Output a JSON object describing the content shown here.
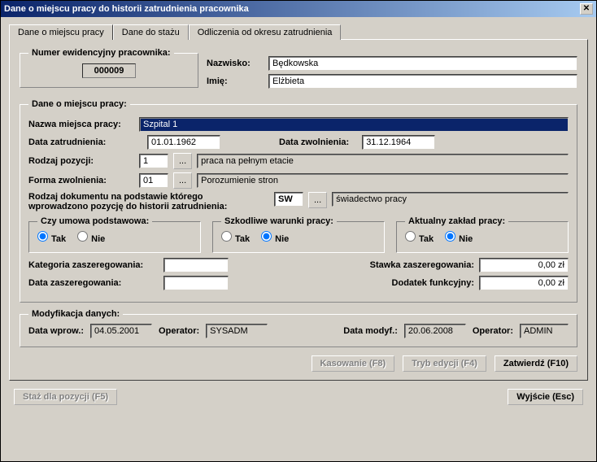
{
  "window": {
    "title": "Dane o miejscu pracy do historii zatrudnienia pracownika"
  },
  "tabs": {
    "t1": "Dane o miejscu pracy",
    "t2": "Dane do stażu",
    "t3": "Odliczenia od okresu zatrudnienia"
  },
  "emp": {
    "group_label": "Numer ewidencyjny pracownika:",
    "id": "000009",
    "surname_label": "Nazwisko:",
    "surname": "Będkowska",
    "firstname_label": "Imię:",
    "firstname": "Elżbieta"
  },
  "workplace": {
    "group_label": "Dane o miejscu pracy:",
    "name_label": "Nazwa miejsca pracy:",
    "name": "Szpital 1",
    "hire_date_label": "Data zatrudnienia:",
    "hire_date": "01.01.1962",
    "term_date_label": "Data zwolnienia:",
    "term_date": "31.12.1964",
    "position_type_label": "Rodzaj pozycji:",
    "position_type_code": "1",
    "position_type_desc": "praca na pełnym etacie",
    "term_form_label": "Forma zwolnienia:",
    "term_form_code": "01",
    "term_form_desc": "Porozumienie stron",
    "doc_type_label_1": "Rodzaj dokumentu na podstawie którego",
    "doc_type_label_2": "wprowadzono pozycję do historii zatrudnienia:",
    "doc_type_code": "SW",
    "doc_type_desc": "świadectwo pracy",
    "lookup_btn": "..."
  },
  "radios": {
    "base_contract_label": "Czy umowa podstawowa:",
    "harmful_label": "Szkodliwe warunki pracy:",
    "current_plant_label": "Aktualny zakład pracy:",
    "yes": "Tak",
    "no": "Nie",
    "base_contract": "yes",
    "harmful": "no",
    "current_plant": "no"
  },
  "grade": {
    "category_label": "Kategoria zaszeregowania:",
    "category": "",
    "rate_label": "Stawka zaszeregowania:",
    "rate": "0,00 zł",
    "date_label": "Data zaszeregowania:",
    "date": "",
    "bonus_label": "Dodatek funkcyjny:",
    "bonus": "0,00 zł"
  },
  "mod": {
    "group_label": "Modyfikacja danych:",
    "entry_date_label": "Data wprow.:",
    "entry_date": "04.05.2001",
    "operator1_label": "Operator:",
    "operator1": "SYSADM",
    "mod_date_label": "Data modyf.:",
    "mod_date": "20.06.2008",
    "operator2_label": "Operator:",
    "operator2": "ADMIN"
  },
  "buttons": {
    "delete": "Kasowanie (F8)",
    "edit": "Tryb edycji (F4)",
    "confirm": "Zatwierdź (F10)",
    "seniority": "Staż dla pozycji (F5)",
    "exit": "Wyjście (Esc)"
  }
}
